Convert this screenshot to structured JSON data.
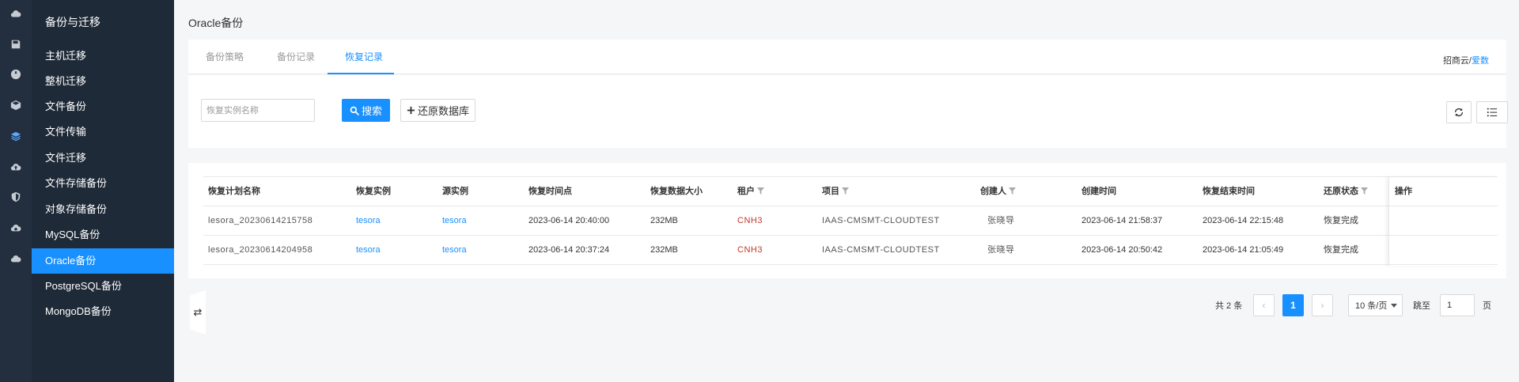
{
  "rail": {
    "icons": [
      "cloud-icon",
      "save-icon",
      "globe-icon",
      "box-icon",
      "layers-icon",
      "cloud-up-icon",
      "shield-icon",
      "cloud-gear-icon",
      "cloud-data-icon"
    ],
    "active_index": 4
  },
  "subnav": {
    "title": "备份与迁移",
    "items": [
      {
        "label": "主机迁移"
      },
      {
        "label": "整机迁移"
      },
      {
        "label": "文件备份"
      },
      {
        "label": "文件传输"
      },
      {
        "label": "文件迁移"
      },
      {
        "label": "文件存储备份"
      },
      {
        "label": "对象存储备份"
      },
      {
        "label": "MySQL备份"
      },
      {
        "label": "Oracle备份"
      },
      {
        "label": "PostgreSQL备份"
      },
      {
        "label": "MongoDB备份"
      }
    ],
    "active_label": "Oracle备份",
    "collapse_glyph": "⇄"
  },
  "page": {
    "title": "Oracle备份"
  },
  "tabs": {
    "items": [
      {
        "label": "备份策略"
      },
      {
        "label": "备份记录"
      },
      {
        "label": "恢复记录"
      }
    ],
    "active_index": 2,
    "crumb_prefix": "招商云/",
    "crumb_link": "爱数"
  },
  "toolbar": {
    "search_placeholder": "恢复实例名称",
    "search_label": "搜索",
    "restore_label": "还原数据库",
    "refresh_icon": "refresh-icon",
    "columns_icon": "list-icon"
  },
  "table": {
    "columns": [
      {
        "label": "恢复计划名称",
        "filter": false
      },
      {
        "label": "恢复实例",
        "filter": false
      },
      {
        "label": "源实例",
        "filter": false
      },
      {
        "label": "恢复时间点",
        "filter": false
      },
      {
        "label": "恢复数据大小",
        "filter": false
      },
      {
        "label": "租户",
        "filter": true
      },
      {
        "label": "项目",
        "filter": true
      },
      {
        "label": "创建人",
        "filter": true
      },
      {
        "label": "创建时间",
        "filter": false
      },
      {
        "label": "恢复结束时间",
        "filter": false
      },
      {
        "label": "还原状态",
        "filter": true
      },
      {
        "label": "操作",
        "filter": false
      }
    ],
    "rows": [
      {
        "plan_name": "lesora_20230614215758",
        "restore_instance": "tesora",
        "source_instance": "tesora",
        "restore_point": "2023-06-14 20:40:00",
        "data_size": "232MB",
        "tenant": "CNH3",
        "project": "IAAS-CMSMT-CLOUDTEST",
        "creator": "张晓导",
        "created_at": "2023-06-14 21:58:37",
        "ended_at": "2023-06-14 22:15:48",
        "status": "恢复完成"
      },
      {
        "plan_name": "lesora_20230614204958",
        "restore_instance": "tesora",
        "source_instance": "tesora",
        "restore_point": "2023-06-14 20:37:24",
        "data_size": "232MB",
        "tenant": "CNH3",
        "project": "IAAS-CMSMT-CLOUDTEST",
        "creator": "张晓导",
        "created_at": "2023-06-14 20:50:42",
        "ended_at": "2023-06-14 21:05:49",
        "status": "恢复完成"
      }
    ]
  },
  "pagination": {
    "total_text": "共 2 条",
    "current_page": "1",
    "page_size_label": "10 条/页",
    "jump_label": "跳至",
    "jump_value": "1",
    "page_suffix": "页",
    "prev_glyph": "‹",
    "next_glyph": "›"
  },
  "colors": {
    "accent": "#1890ff",
    "rail_bg": "#232f3e",
    "subnav_bg": "#1f2a38"
  }
}
